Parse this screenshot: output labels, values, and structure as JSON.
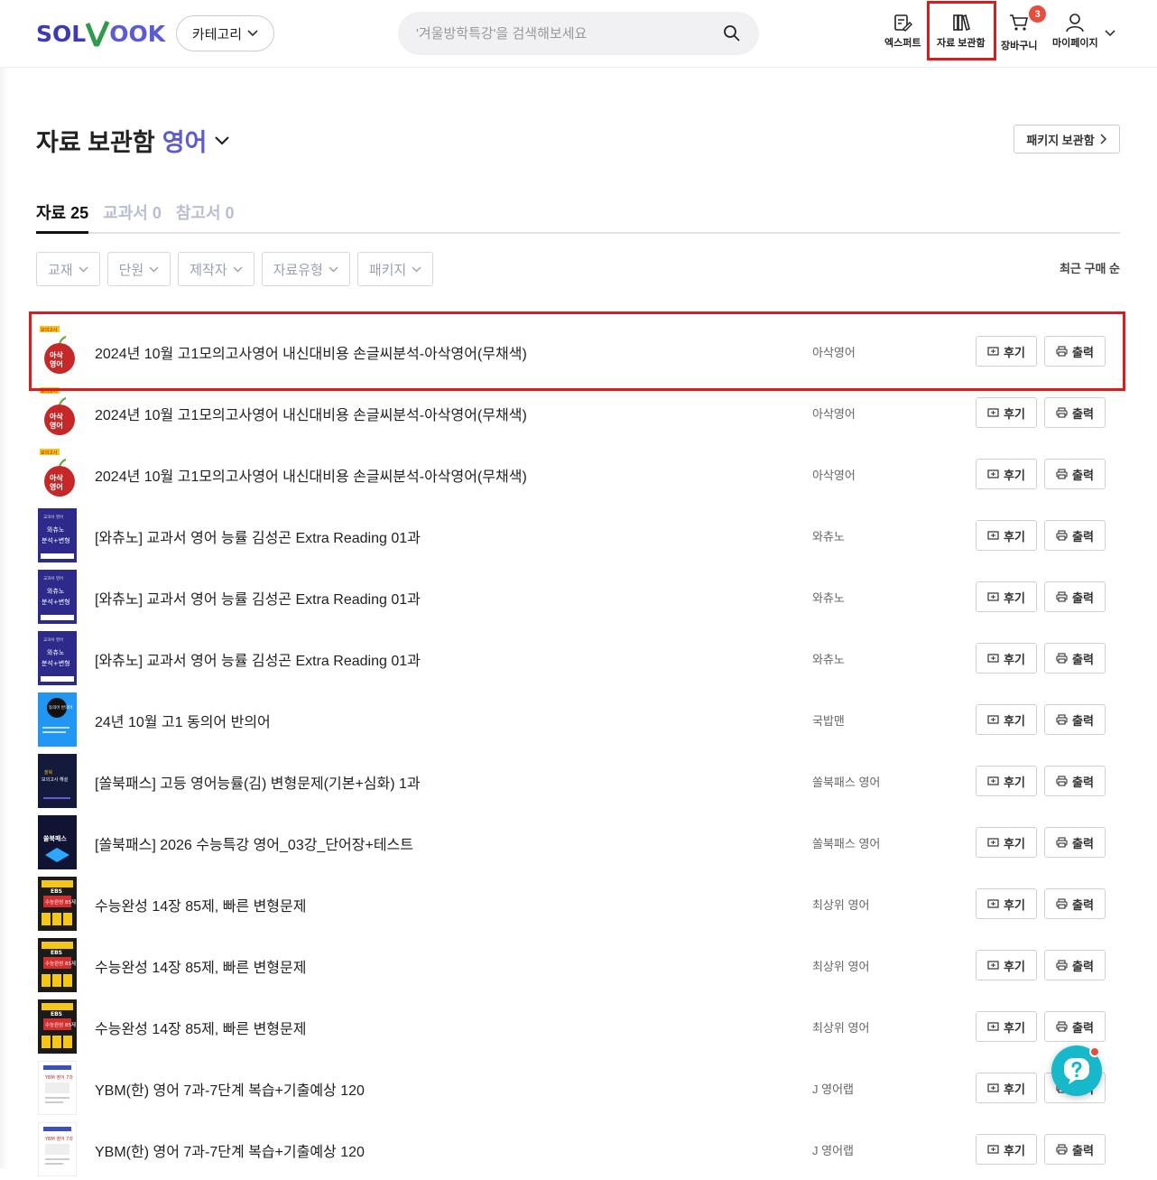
{
  "header": {
    "logo": {
      "left": "SOL",
      "right": "OOK"
    },
    "category_label": "카테고리",
    "search_placeholder": "'겨울방학특강'을 검색해보세요",
    "nav": {
      "expert": "엑스퍼트",
      "library": "자료 보관함",
      "cart": "장바구니",
      "cart_count": "3",
      "mypage": "마이페이지"
    }
  },
  "page": {
    "title": "자료 보관함",
    "subject": "영어",
    "package_button": "패키지 보관함"
  },
  "tabs": [
    {
      "label": "자료 25"
    },
    {
      "label": "교과서 0"
    },
    {
      "label": "참고서 0"
    }
  ],
  "filters": [
    "교재",
    "단원",
    "제작자",
    "자료유형",
    "패키지"
  ],
  "sort_label": "최근 구매 순",
  "row_buttons": {
    "review": "후기",
    "print": "출력"
  },
  "thumb_text": {
    "asak_top": "모의고사",
    "asak_main": "아삭 영어",
    "wachu_top": "교과서 영어",
    "wachu_main": "와츄노 분석+변형",
    "gukbap": "동의어 반의어",
    "ssulbook_d": "쏠북 모의고사 해설",
    "ssulbook_t": "쏠북패스",
    "ebs_top": "EBS",
    "ebs_main": "수능완성 85제",
    "ybm": "YBM 영어 7과"
  },
  "items": [
    {
      "title": "2024년 10월 고1모의고사영어 내신대비용 손글씨분석-아삭영어(무채색)",
      "author": "아삭영어",
      "thumb": "asak"
    },
    {
      "title": "2024년 10월 고1모의고사영어 내신대비용 손글씨분석-아삭영어(무채색)",
      "author": "아삭영어",
      "thumb": "asak"
    },
    {
      "title": "2024년 10월 고1모의고사영어 내신대비용 손글씨분석-아삭영어(무채색)",
      "author": "아삭영어",
      "thumb": "asak"
    },
    {
      "title": "[와츄노] 교과서 영어 능률 김성곤 Extra Reading 01과",
      "author": "와츄노",
      "thumb": "wachu"
    },
    {
      "title": "[와츄노] 교과서 영어 능률 김성곤 Extra Reading 01과",
      "author": "와츄노",
      "thumb": "wachu"
    },
    {
      "title": "[와츄노] 교과서 영어 능률 김성곤 Extra Reading 01과",
      "author": "와츄노",
      "thumb": "wachu"
    },
    {
      "title": "24년 10월 고1 동의어 반의어",
      "author": "국밥맨",
      "thumb": "gukbap"
    },
    {
      "title": "[쏠북패스] 고등 영어능률(김) 변형문제(기본+심화) 1과",
      "author": "쏠북패스 영어",
      "thumb": "ssulbook_d"
    },
    {
      "title": "[쏠북패스] 2026 수능특강 영어_03강_단어장+테스트",
      "author": "쏠북패스 영어",
      "thumb": "ssulbook_t"
    },
    {
      "title": "수능완성 14장 85제, 빠른 변형문제",
      "author": "최상위 영어",
      "thumb": "ebs"
    },
    {
      "title": "수능완성 14장 85제, 빠른 변형문제",
      "author": "최상위 영어",
      "thumb": "ebs"
    },
    {
      "title": "수능완성 14장 85제, 빠른 변형문제",
      "author": "최상위 영어",
      "thumb": "ebs"
    },
    {
      "title": "YBM(한) 영어 7과-7단계 복습+기출예상 120",
      "author": "J 영어랩",
      "thumb": "ybm"
    },
    {
      "title": "YBM(한) 영어 7과-7단계 복습+기출예상 120",
      "author": "J 영어랩",
      "thumb": "ybm"
    }
  ],
  "colors": {
    "brand": "#5b5bd6",
    "highlight": "#d91c1c",
    "fab": "#17b8c9",
    "badge": "#e74c3c"
  }
}
